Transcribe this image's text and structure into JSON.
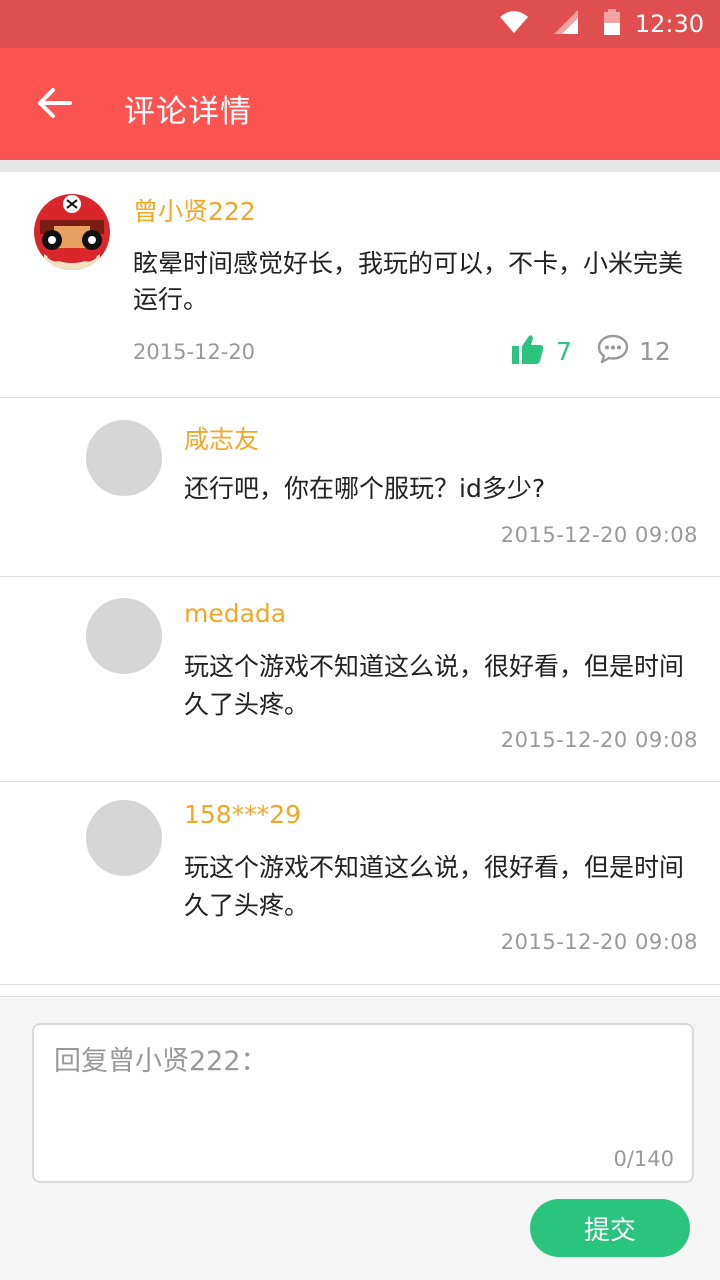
{
  "status_bar": {
    "time": "12:30"
  },
  "app_bar": {
    "title": "评论详情"
  },
  "main_comment": {
    "username": "曾小贤222",
    "text": "眩晕时间感觉好长，我玩的可以，不卡，小米完美运行。",
    "date": "2015-12-20",
    "likes": "7",
    "comments": "12"
  },
  "replies": [
    {
      "username": "咸志友",
      "text": "还行吧，你在哪个服玩？id多少?",
      "date": "2015-12-20  09:08"
    },
    {
      "username": "medada",
      "text": "玩这个游戏不知道这么说，很好看，但是时间久了头疼。",
      "date": "2015-12-20  09:08"
    },
    {
      "username": "158***29",
      "text": "玩这个游戏不知道这么说，很好看，但是时间久了头疼。",
      "date": "2015-12-20  09:08"
    }
  ],
  "reply_form": {
    "placeholder": "回复曾小贤222：",
    "value": "",
    "char_count": "0/140",
    "submit_label": "提交"
  },
  "colors": {
    "primary": "#fb5451",
    "status_bar": "#e04f50",
    "username": "#f5a623",
    "accent_green": "#2bc47d"
  },
  "icons": {
    "back": "arrow-left-icon",
    "like": "thumbs-up-icon",
    "comment": "speech-bubble-icon",
    "wifi": "wifi-icon",
    "signal": "signal-icon",
    "battery": "battery-icon"
  }
}
